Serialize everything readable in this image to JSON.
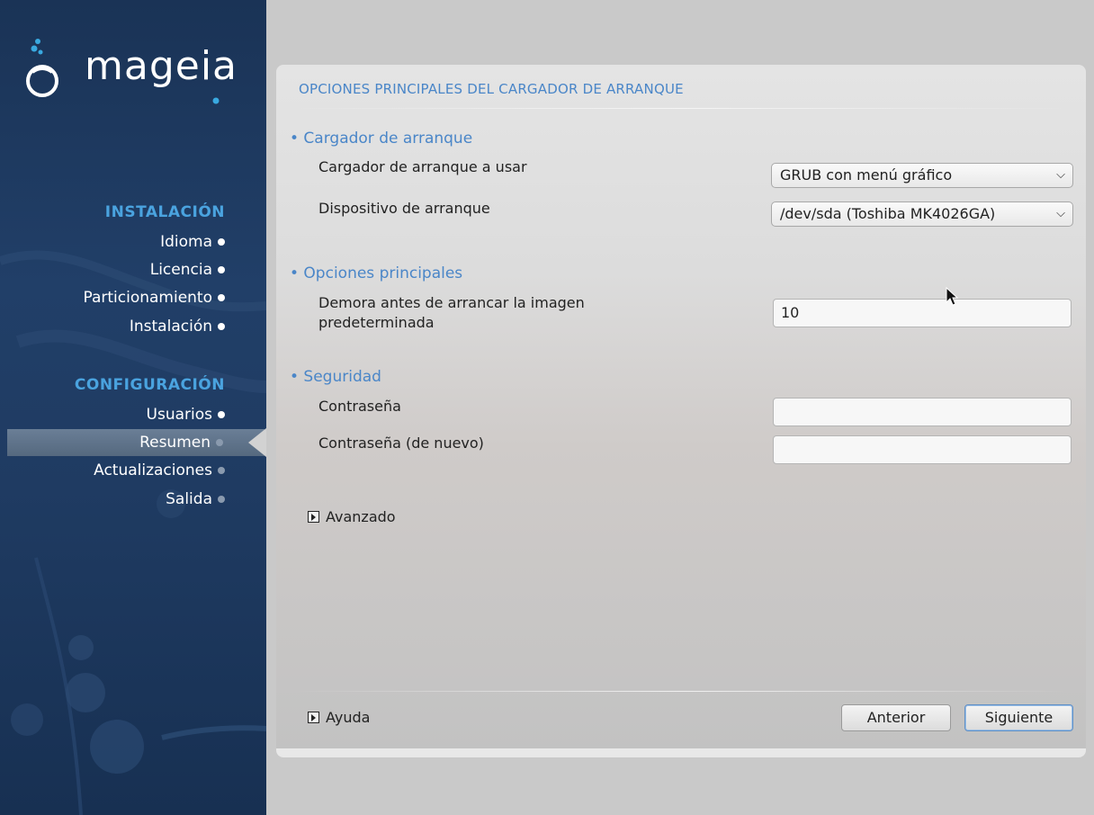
{
  "sidebar": {
    "logo_text": "mageia",
    "sections": [
      {
        "title": "INSTALACIÓN",
        "items": [
          {
            "label": "Idioma",
            "state": "done"
          },
          {
            "label": "Licencia",
            "state": "done"
          },
          {
            "label": "Particionamiento",
            "state": "done"
          },
          {
            "label": "Instalación",
            "state": "done"
          }
        ]
      },
      {
        "title": "CONFIGURACIÓN",
        "items": [
          {
            "label": "Usuarios",
            "state": "done"
          },
          {
            "label": "Resumen",
            "state": "active"
          },
          {
            "label": "Actualizaciones",
            "state": "pending"
          },
          {
            "label": "Salida",
            "state": "pending"
          }
        ]
      }
    ]
  },
  "main": {
    "title": "OPCIONES PRINCIPALES DEL CARGADOR DE ARRANQUE",
    "groups": {
      "bootloader": {
        "heading": "• Cargador de arranque",
        "loader_label": "Cargador de arranque a usar",
        "loader_value": "GRUB con menú gráfico",
        "device_label": "Dispositivo de arranque",
        "device_value": "/dev/sda (Toshiba MK4026GA)"
      },
      "main_options": {
        "heading": "• Opciones principales",
        "delay_label_line1": "Demora antes de arrancar la imagen",
        "delay_label_line2": "predeterminada",
        "delay_value": "10"
      },
      "security": {
        "heading": "• Seguridad",
        "password_label": "Contraseña",
        "password_value": "",
        "password_again_label": "Contraseña (de nuevo)",
        "password_again_value": ""
      }
    },
    "advanced_label": "Avanzado",
    "help_label": "Ayuda",
    "back_label": "Anterior",
    "next_label": "Siguiente"
  },
  "colors": {
    "accent": "#4a86c8",
    "sidebar_section": "#4aa3df",
    "sidebar_bg": "#1f3b62"
  }
}
